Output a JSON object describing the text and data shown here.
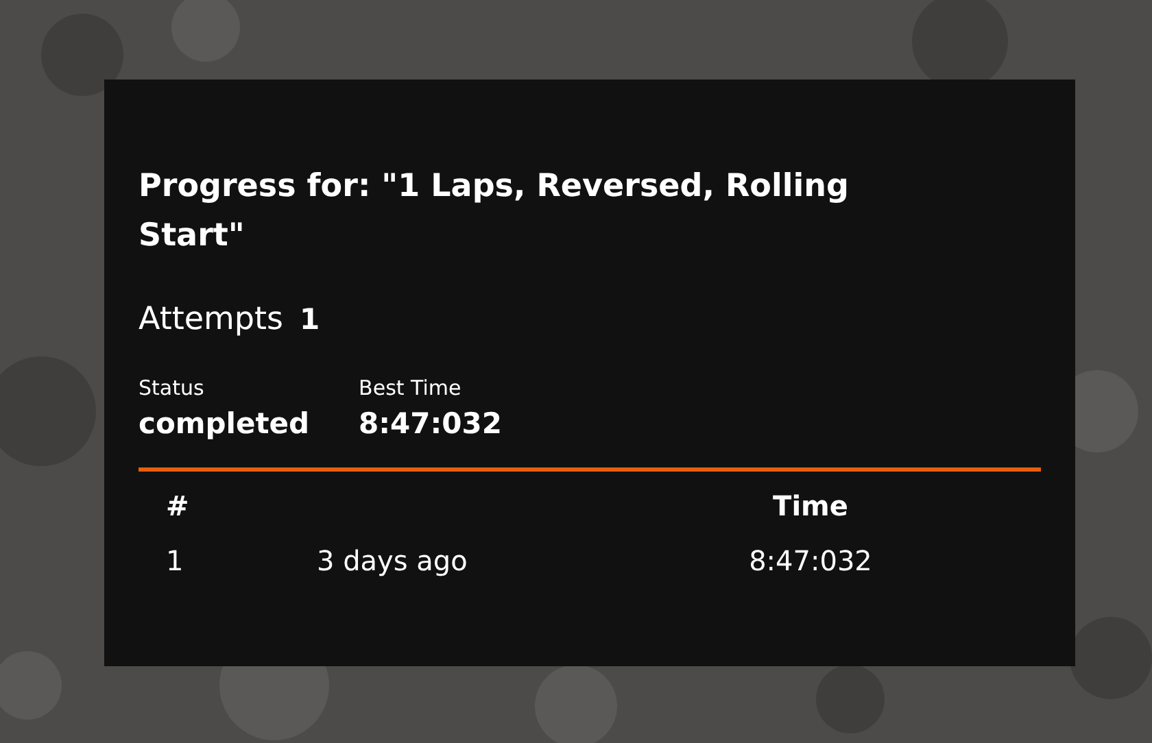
{
  "title": "Progress for: \"1 Laps, Reversed, Rolling Start\"",
  "attempts": {
    "label": "Attempts",
    "value": "1"
  },
  "stats": [
    {
      "label": "Status",
      "value": "completed"
    },
    {
      "label": "Best Time",
      "value": "8:47:032"
    }
  ],
  "table": {
    "columns": [
      "#",
      "",
      "Time"
    ],
    "rows": [
      [
        "1",
        "3 days ago",
        "8:47:032"
      ]
    ]
  }
}
